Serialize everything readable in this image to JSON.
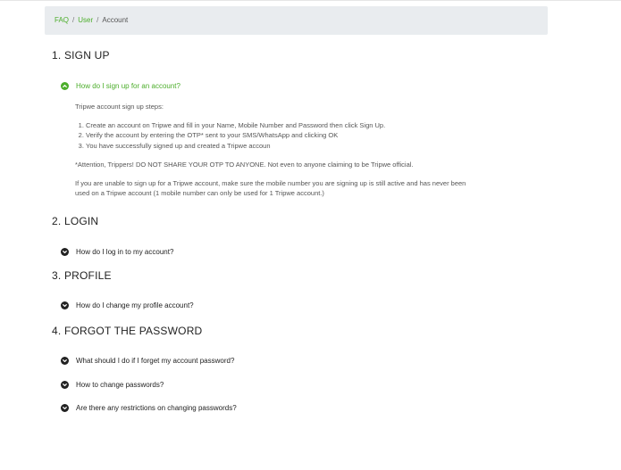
{
  "breadcrumb": {
    "items": [
      "FAQ",
      "User"
    ],
    "current": "Account",
    "separator": "/"
  },
  "sections": [
    {
      "title": "1. SIGN UP"
    },
    {
      "title": "2. LOGIN"
    },
    {
      "title": "3. PROFILE"
    },
    {
      "title": "4. FORGOT THE PASSWORD"
    }
  ],
  "questions": {
    "signup": "How do I sign up for an account?",
    "login": "How do I log in to my account?",
    "profile": "How do I change my profile account?",
    "forgot": "What should I do if I forget my account password?",
    "change": "How to change passwords?",
    "restrictions": "Are there any restrictions on changing passwords?"
  },
  "signup_answer": {
    "intro": "Tripwe account sign up steps:",
    "steps": [
      "Create an account on Tripwe and fill in your Name, Mobile Number and Password then click Sign Up.",
      "Verify the account by entering the OTP* sent to your SMS/WhatsApp and clicking OK",
      "You have successfully signed up and created a Tripwe accoun"
    ],
    "attention": "*Attention, Trippers! DO NOT SHARE YOUR OTP TO ANYONE. Not even to anyone claiming to be Tripwe official.",
    "note": "If you are unable to sign up for a Tripwe account, make sure the mobile number you are signing up is still active and has never been used on a Tripwe account (1 mobile number can only be used for 1 Tripwe account.)"
  },
  "colors": {
    "accent": "#4cae2b",
    "breadcrumb_bg": "#e9ecef"
  },
  "icons": {
    "open": "chevron-up-circle-icon",
    "closed": "chevron-down-circle-icon"
  }
}
